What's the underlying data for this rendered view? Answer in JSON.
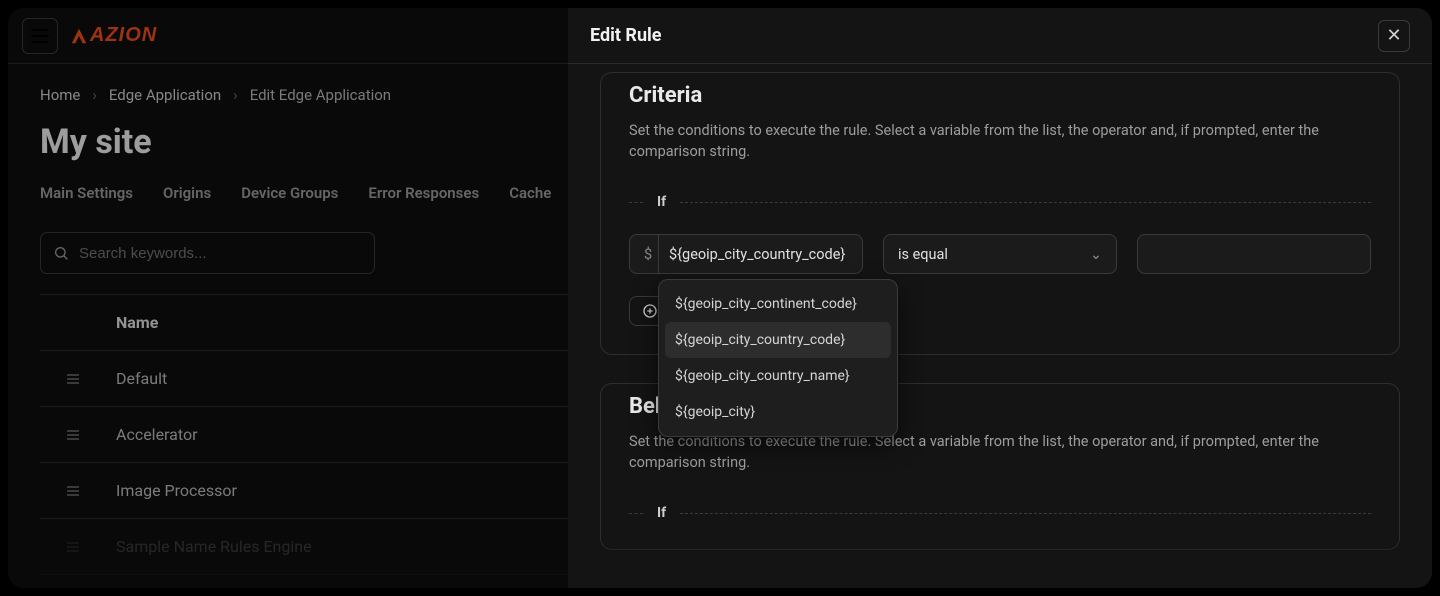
{
  "header": {},
  "breadcrumb": {
    "items": [
      "Home",
      "Edge Application",
      "Edit Edge Application"
    ]
  },
  "page": {
    "title": "My site"
  },
  "tabs": [
    "Main Settings",
    "Origins",
    "Device Groups",
    "Error Responses",
    "Cache"
  ],
  "search": {
    "placeholder": "Search keywords..."
  },
  "table": {
    "header": "Name",
    "rows": [
      "Default",
      "Accelerator",
      "Image Processor",
      "Sample Name Rules Engine"
    ]
  },
  "drawer": {
    "title": "Edit Rule",
    "criteria": {
      "heading": "Criteria",
      "desc": "Set the conditions to execute the rule. Select a variable from the list, the operator and, if prompted, enter the comparison string.",
      "if_label": "If",
      "variable_prefix": "$",
      "variable": "${geoip_city_country_code}",
      "operator": "is equal",
      "value": "",
      "dropdown": [
        "${geoip_city_continent_code}",
        "${geoip_city_country_code}",
        "${geoip_city_country_name}",
        "${geoip_city}"
      ],
      "dropdown_selected_index": 1
    },
    "behaviours": {
      "heading": "Behaviours",
      "desc": "Set the conditions to execute the rule. Select a variable from the list, the operator and, if prompted, enter the comparison string.",
      "if_label": "If"
    }
  }
}
